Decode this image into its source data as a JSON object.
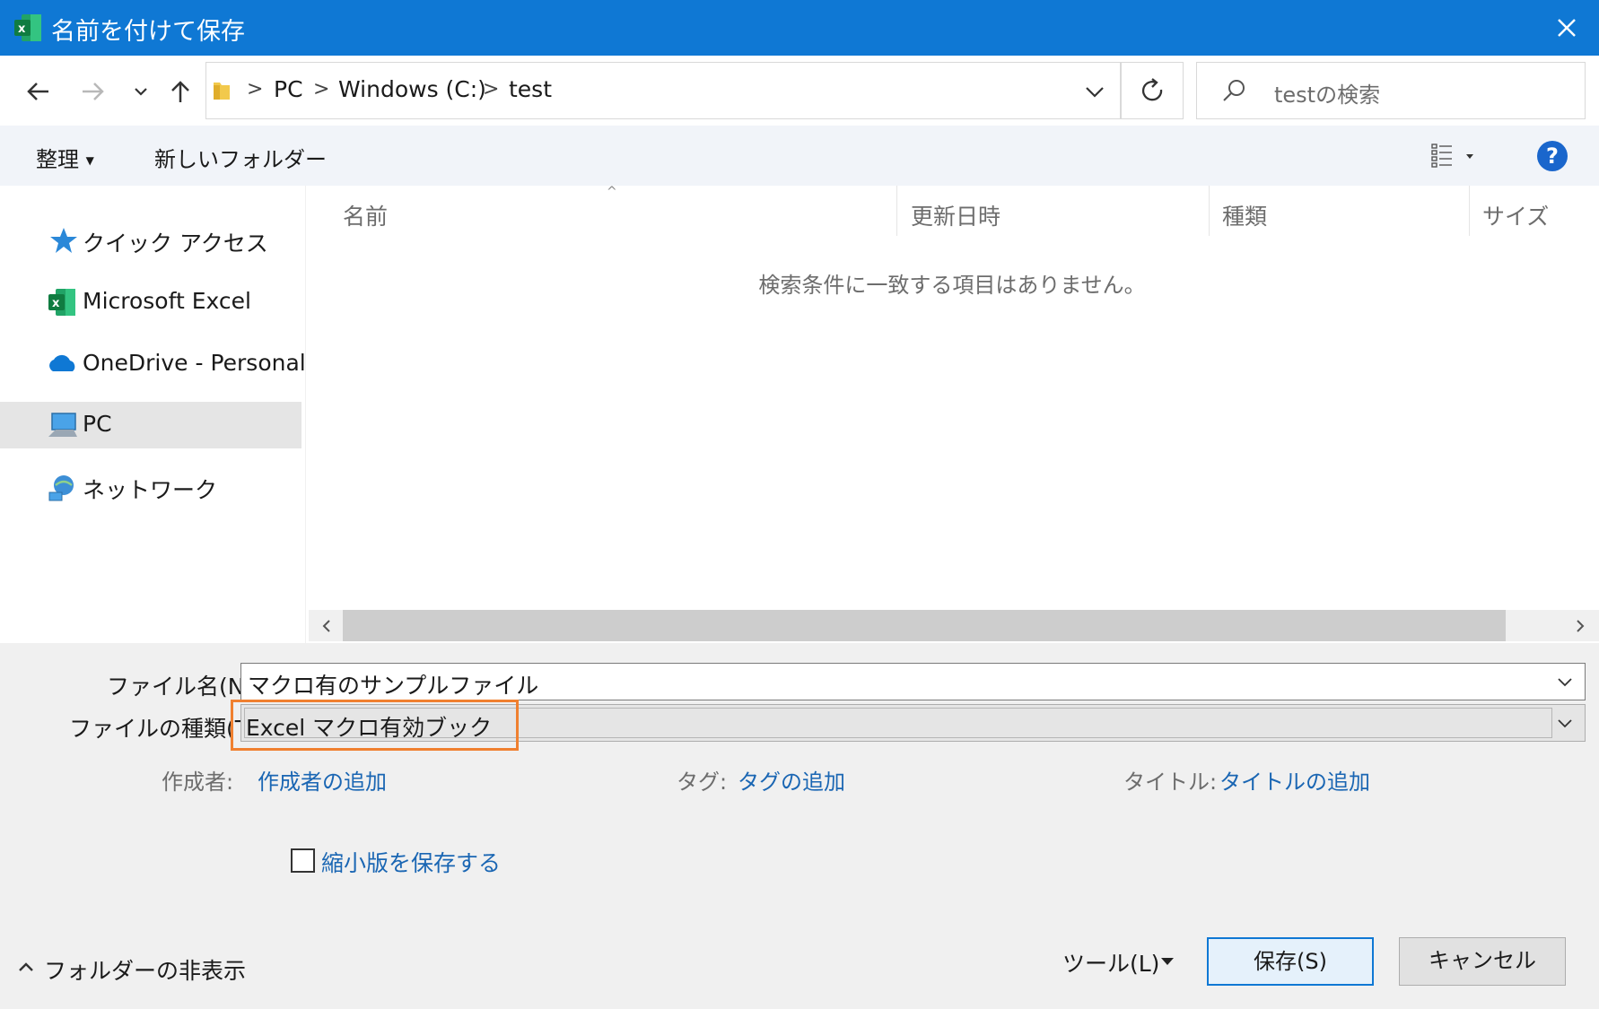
{
  "window": {
    "title": "名前を付けて保存",
    "app_icon": "excel-icon"
  },
  "navigation": {
    "back_icon": "arrow-left-icon",
    "forward_icon": "arrow-right-icon",
    "recent_icon": "chevron-down-icon",
    "up_icon": "arrow-up-icon",
    "breadcrumb": [
      "PC",
      "Windows (C:)",
      "test"
    ],
    "refresh_icon": "refresh-icon",
    "search_placeholder": "testの検索"
  },
  "toolbar": {
    "organize_label": "整理",
    "new_folder_label": "新しいフォルダー",
    "view_icon": "details-view-icon",
    "help_label": "?"
  },
  "sidebar": {
    "items": [
      {
        "label": "クイック アクセス",
        "icon": "star-icon"
      },
      {
        "label": "Microsoft Excel",
        "icon": "excel-icon"
      },
      {
        "label": "OneDrive - Personal",
        "icon": "cloud-icon"
      },
      {
        "label": "PC",
        "icon": "computer-icon",
        "selected": true
      },
      {
        "label": "ネットワーク",
        "icon": "network-icon"
      }
    ]
  },
  "file_list": {
    "columns": [
      "名前",
      "更新日時",
      "種類",
      "サイズ"
    ],
    "sort_column": "名前",
    "empty_message": "検索条件に一致する項目はありません。"
  },
  "form": {
    "filename_label": "ファイル名(N):",
    "filename_value": "マクロ有のサンプルファイル",
    "filetype_label": "ファイルの種類(T):",
    "filetype_value": "Excel マクロ有効ブック",
    "author_label": "作成者:",
    "author_link": "作成者の追加",
    "tags_label": "タグ:",
    "tags_link": "タグの追加",
    "title_label": "タイトル:",
    "title_link": "タイトルの追加",
    "thumbnail_label": "縮小版を保存する",
    "thumbnail_checked": false
  },
  "footer": {
    "hide_folders_label": "フォルダーの非表示",
    "tools_label": "ツール(L)",
    "save_label": "保存(S)",
    "cancel_label": "キャンセル"
  },
  "colors": {
    "titlebar": "#0f78d4",
    "highlight": "#f08030",
    "link": "#1a66b3"
  }
}
